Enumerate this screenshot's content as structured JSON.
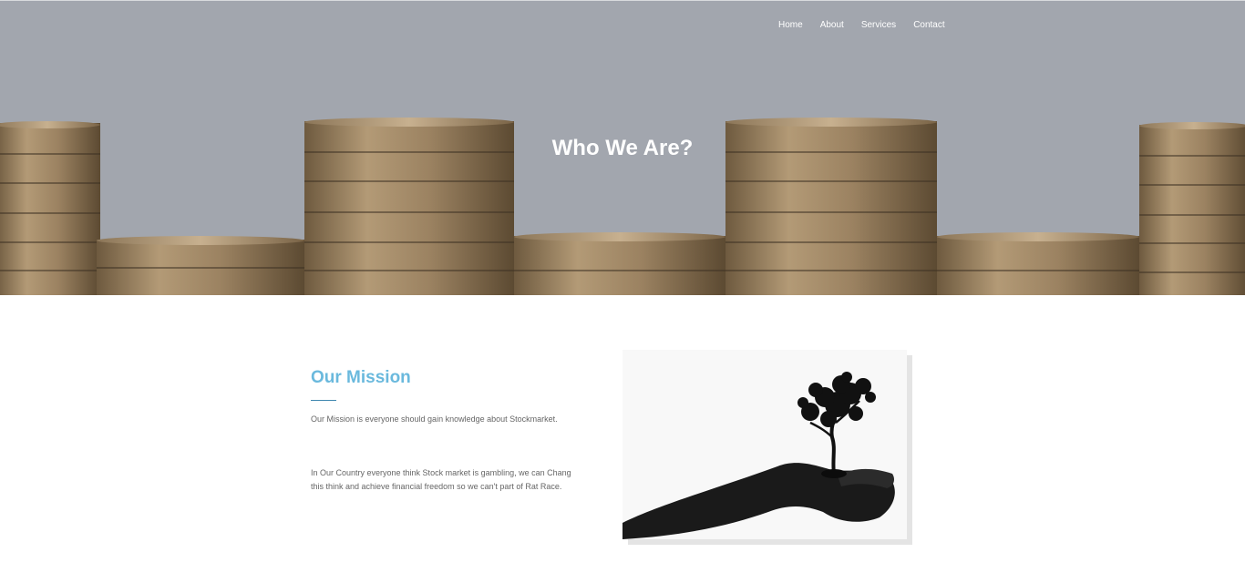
{
  "nav": {
    "items": [
      "Home",
      "About",
      "Services",
      "Contact"
    ]
  },
  "hero": {
    "title": "Who We Are?"
  },
  "mission": {
    "title": "Our Mission",
    "paragraph_1": "Our Mission is everyone should gain knowledge about Stockmarket.",
    "paragraph_2": "In Our Country everyone think Stock market is gambling, we can Chang this think and achieve financial freedom so we can't part of Rat Race."
  },
  "colors": {
    "hero_background": "#a2a6ae",
    "accent": "#6ab9dd",
    "rule": "#3f87b0",
    "body_text": "#666666"
  },
  "images": {
    "hero": "stacked-pound-coins",
    "mission": "hand-holding-tree"
  }
}
